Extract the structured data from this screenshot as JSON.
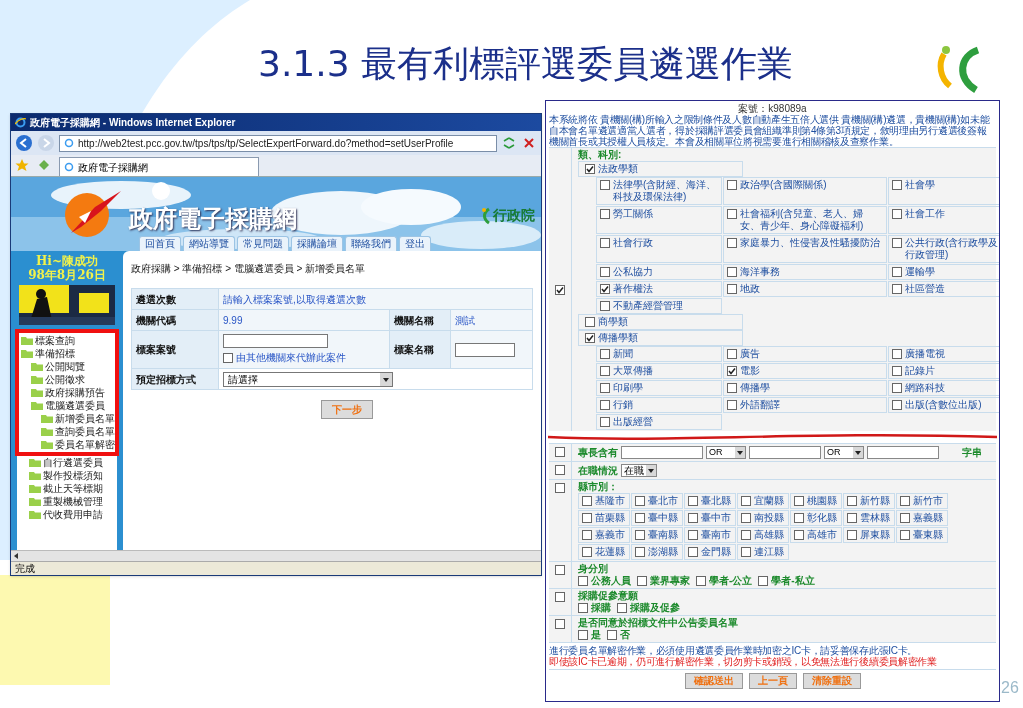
{
  "slide": {
    "title": "3.1.3 最有利標評選委員遴選作業",
    "page_number": "26"
  },
  "browser": {
    "title": "政府電子採購網 - Windows Internet Explorer",
    "address": "http://web2test.pcc.gov.tw/tps/tps/tp/SelectExpertForward.do?method=setUserProfile",
    "tab": "政府電子採購網",
    "status": "完成"
  },
  "site": {
    "name": "政府電子採購網",
    "agency": "行政院",
    "nav": [
      "回首頁",
      "網站導覽",
      "常見問題",
      "採購論壇",
      "聯絡我們",
      "登出"
    ],
    "greeting": "Hi~陳成功",
    "date": "98年8月26日",
    "breadcrumb": "政府採購 > 準備招標 > 電腦遴選委員 > 新增委員名單"
  },
  "tree": [
    {
      "label": "標案查詢",
      "highlighted": true
    },
    {
      "label": "準備招標",
      "highlighted": true,
      "children": [
        {
          "label": "公開閱覽",
          "highlighted": true
        },
        {
          "label": "公開徵求",
          "highlighted": true
        },
        {
          "label": "政府採購預告",
          "highlighted": true
        },
        {
          "label": "電腦遴選委員",
          "highlighted": true,
          "children": [
            {
              "label": "新增委員名單",
              "highlighted": true
            },
            {
              "label": "查詢委員名單",
              "highlighted": true
            },
            {
              "label": "委員名單解密",
              "highlighted": true
            }
          ]
        },
        {
          "label": "自行遴選委員",
          "highlighted": false
        },
        {
          "label": "製作投標須知",
          "highlighted": false
        },
        {
          "label": "截止天等標期",
          "highlighted": false
        },
        {
          "label": "重製機械管理",
          "highlighted": false
        },
        {
          "label": "代收費用申請",
          "highlighted": false
        }
      ]
    }
  ],
  "form": {
    "count_label": "遴選次數",
    "count_hint": "請輸入標案案號,以取得遴選次數",
    "agency_code_label": "機關代碼",
    "agency_code": "9.99",
    "agency_name_label": "機關名稱",
    "agency_name": "測試",
    "case_no_label": "標案案號",
    "proxy": {
      "label": "由其他機關來代辦此案件",
      "checked": false
    },
    "case_name_label": "標案名稱",
    "method_label": "預定招標方式",
    "method_value": "請選擇",
    "next_button": "下一步"
  },
  "criteria": {
    "case_no": "案號：k98089a",
    "notice": "本系統將依 貴機關(構)所輸入之限制條件及人數自動產生五倍人選供 貴機關(構)遴選，貴機關(構)如未能自本會名單遴選適當人選者，得於採購評選委員會組織準則第4條第3項規定，敘明理由另行遴選後簽報機關首長或其授權人員核定。本會及相關單位將視需要進行相關稽核及查察作業。",
    "category": {
      "checked": true,
      "label": "類、科別:",
      "groups": [
        {
          "label": "法政學類",
          "checked": true,
          "items": [
            {
              "label": "法律學(含財經、海洋、科技及環保法律)",
              "checked": false
            },
            {
              "label": "政治學(含國際關係)",
              "checked": false
            },
            {
              "label": "社會學",
              "checked": false
            },
            {
              "label": "勞工關係",
              "checked": false
            },
            {
              "label": "社會福利(含兒童、老人、婦女、青少年、身心障礙福利)",
              "checked": false
            },
            {
              "label": "社會工作",
              "checked": false
            },
            {
              "label": "社會行政",
              "checked": false
            },
            {
              "label": "家庭暴力、性侵害及性騷擾防治",
              "checked": false
            },
            {
              "label": "公共行政(含行政學及行政管理)",
              "checked": false
            },
            {
              "label": "公私協力",
              "checked": false
            },
            {
              "label": "海洋事務",
              "checked": false
            },
            {
              "label": "運輸學",
              "checked": false
            },
            {
              "label": "著作權法",
              "checked": true
            },
            {
              "label": "地政",
              "checked": false
            },
            {
              "label": "社區營造",
              "checked": false
            },
            {
              "label": "不動產經營管理",
              "checked": false
            }
          ]
        },
        {
          "label": "商學類",
          "checked": false
        },
        {
          "label": "傳播學類",
          "checked": true,
          "items": [
            {
              "label": "新聞",
              "checked": false
            },
            {
              "label": "廣告",
              "checked": false
            },
            {
              "label": "廣播電視",
              "checked": false
            },
            {
              "label": "大眾傳播",
              "checked": false
            },
            {
              "label": "電影",
              "checked": true
            },
            {
              "label": "記錄片",
              "checked": false
            },
            {
              "label": "印刷學",
              "checked": false
            },
            {
              "label": "傳播學",
              "checked": false
            },
            {
              "label": "網路科技",
              "checked": false
            },
            {
              "label": "行銷",
              "checked": false
            },
            {
              "label": "外語翻譯",
              "checked": false
            },
            {
              "label": "出版(含數位出版)",
              "checked": false
            },
            {
              "label": "出版經營",
              "checked": false
            }
          ]
        }
      ]
    },
    "expertise": {
      "checked": false,
      "label": "專長含有",
      "operators": [
        "OR",
        "OR"
      ],
      "suffix": "字串"
    },
    "employment": {
      "checked": false,
      "label": "在職情況",
      "value": "在職"
    },
    "counties": {
      "checked": false,
      "label": "縣市別：",
      "items": [
        {
          "label": "基隆市",
          "checked": false
        },
        {
          "label": "臺北市",
          "checked": false
        },
        {
          "label": "臺北縣",
          "checked": false
        },
        {
          "label": "宜蘭縣",
          "checked": false
        },
        {
          "label": "桃園縣",
          "checked": false
        },
        {
          "label": "新竹縣",
          "checked": false
        },
        {
          "label": "新竹市",
          "checked": false
        },
        {
          "label": "苗栗縣",
          "checked": false
        },
        {
          "label": "臺中縣",
          "checked": false
        },
        {
          "label": "臺中市",
          "checked": false
        },
        {
          "label": "南投縣",
          "checked": false
        },
        {
          "label": "彰化縣",
          "checked": false
        },
        {
          "label": "雲林縣",
          "checked": false
        },
        {
          "label": "嘉義縣",
          "checked": false
        },
        {
          "label": "嘉義市",
          "checked": false
        },
        {
          "label": "臺南縣",
          "checked": false
        },
        {
          "label": "臺南市",
          "checked": false
        },
        {
          "label": "高雄縣",
          "checked": false
        },
        {
          "label": "高雄市",
          "checked": false
        },
        {
          "label": "屏東縣",
          "checked": false
        },
        {
          "label": "臺東縣",
          "checked": false
        },
        {
          "label": "花蓮縣",
          "checked": false
        },
        {
          "label": "澎湖縣",
          "checked": false
        },
        {
          "label": "金門縣",
          "checked": false
        },
        {
          "label": "連江縣",
          "checked": false
        }
      ]
    },
    "options": [
      {
        "checked": false,
        "label": "身分別",
        "items": [
          {
            "label": "公務人員",
            "checked": false
          },
          {
            "label": "業界專家",
            "checked": false
          },
          {
            "label": "學者-公立",
            "checked": false
          },
          {
            "label": "學者-私立",
            "checked": false
          }
        ]
      },
      {
        "checked": false,
        "label": "採購促參意願",
        "items": [
          {
            "label": "採購",
            "checked": false
          },
          {
            "label": "採購及促參",
            "checked": false
          }
        ]
      },
      {
        "checked": false,
        "label": "是否同意於招標文件中公告委員名單",
        "items": [
          {
            "label": "是",
            "checked": false
          },
          {
            "label": "否",
            "checked": false
          }
        ]
      }
    ],
    "warnings": [
      {
        "kind": "info",
        "text": "進行委員名單解密作業，必須使用遴選委員作業時加密之IC卡，請妥善保存此張IC卡。"
      },
      {
        "kind": "alert",
        "text": "即使該IC卡已逾期，仍可進行解密作業，切勿剪卡或銷毀，以免無法進行後續委員解密作業"
      }
    ],
    "buttons": [
      "確認送出",
      "上一頁",
      "清除重設"
    ]
  }
}
